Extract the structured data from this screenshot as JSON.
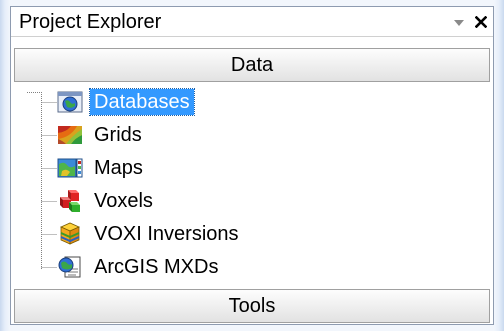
{
  "panel": {
    "title": "Project Explorer",
    "dropdown_icon": "chevron-down-icon",
    "close_icon": "close-icon"
  },
  "sections": {
    "data_label": "Data",
    "tools_label": "Tools"
  },
  "tree": {
    "items": [
      {
        "label": "Databases",
        "icon": "globe-database-icon",
        "selected": true
      },
      {
        "label": "Grids",
        "icon": "grid-raster-icon",
        "selected": false
      },
      {
        "label": "Maps",
        "icon": "map-icon",
        "selected": false
      },
      {
        "label": "Voxels",
        "icon": "voxel-cubes-icon",
        "selected": false
      },
      {
        "label": "VOXI Inversions",
        "icon": "voxi-inversion-icon",
        "selected": false
      },
      {
        "label": "ArcGIS MXDs",
        "icon": "arcgis-mxd-icon",
        "selected": false
      }
    ]
  },
  "colors": {
    "selection_bg": "#3399ff",
    "selection_text": "#ffffff",
    "panel_border": "#8e9bb0",
    "window_bg": "#dae5f4"
  }
}
